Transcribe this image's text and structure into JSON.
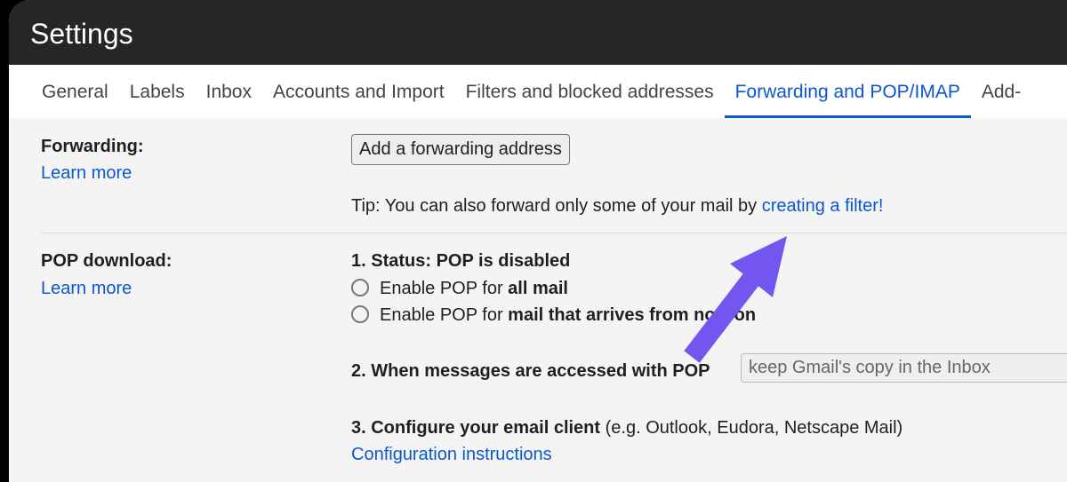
{
  "header": {
    "title": "Settings"
  },
  "tabs": [
    {
      "label": "General"
    },
    {
      "label": "Labels"
    },
    {
      "label": "Inbox"
    },
    {
      "label": "Accounts and Import"
    },
    {
      "label": "Filters and blocked addresses"
    },
    {
      "label": "Forwarding and POP/IMAP",
      "active": true
    },
    {
      "label": "Add-"
    }
  ],
  "forwarding": {
    "label": "Forwarding:",
    "learn_more": "Learn more",
    "button": "Add a forwarding address",
    "tip": "Tip: You can also forward only some of your mail by ",
    "tip_link": "creating a filter!"
  },
  "pop": {
    "label": "POP download:",
    "learn_more": "Learn more",
    "status_prefix": "1. Status: POP is disabled",
    "option1_prefix": "Enable POP for ",
    "option1_bold": "all mail",
    "option2_prefix": "Enable POP for ",
    "option2_bold": "mail that arrives from now on",
    "access_label": "2. When messages are accessed with POP",
    "access_value": "keep Gmail's copy in the Inbox",
    "configure_bold": "3. Configure your email client",
    "configure_rest": " (e.g. Outlook, Eudora, Netscape Mail)",
    "config_link": "Configuration instructions"
  },
  "annotation": {
    "arrow_color": "#7256ef",
    "icon": "arrow-up-right-icon"
  }
}
